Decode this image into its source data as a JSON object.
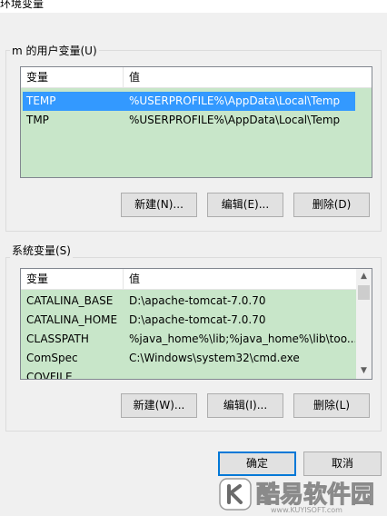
{
  "window": {
    "title": "环境变量"
  },
  "user_section": {
    "label": "m 的用户变量(U)",
    "columns": [
      "变量",
      "值"
    ],
    "rows": [
      {
        "name": "TEMP",
        "value": "%USERPROFILE%\\AppData\\Local\\Temp",
        "selected": true
      },
      {
        "name": "TMP",
        "value": "%USERPROFILE%\\AppData\\Local\\Temp",
        "selected": false
      }
    ],
    "buttons": {
      "new": "新建(N)...",
      "edit": "编辑(E)...",
      "delete": "删除(D)"
    }
  },
  "system_section": {
    "label": "系统变量(S)",
    "columns": [
      "变量",
      "值"
    ],
    "rows": [
      {
        "name": "CATALINA_BASE",
        "value": "D:\\apache-tomcat-7.0.70"
      },
      {
        "name": "CATALINA_HOME",
        "value": "D:\\apache-tomcat-7.0.70"
      },
      {
        "name": "CLASSPATH",
        "value": "%java_home%\\lib;%java_home%\\lib\\too..."
      },
      {
        "name": "ComSpec",
        "value": "C:\\Windows\\system32\\cmd.exe"
      },
      {
        "name": "COVFILE",
        "value": ""
      }
    ],
    "buttons": {
      "new": "新建(W)...",
      "edit": "编辑(I)...",
      "delete": "删除(L)"
    }
  },
  "footer": {
    "ok": "确定",
    "cancel": "取消"
  },
  "watermark": {
    "brand": "酷易软件园",
    "site": "www.KUYISOFT.com"
  },
  "colors": {
    "list_bg": "#c8e6c9",
    "selection": "#3399ff",
    "default_button_border": "#0078d7"
  },
  "icons": {
    "scroll_up": "▲",
    "scroll_down": "▼"
  }
}
